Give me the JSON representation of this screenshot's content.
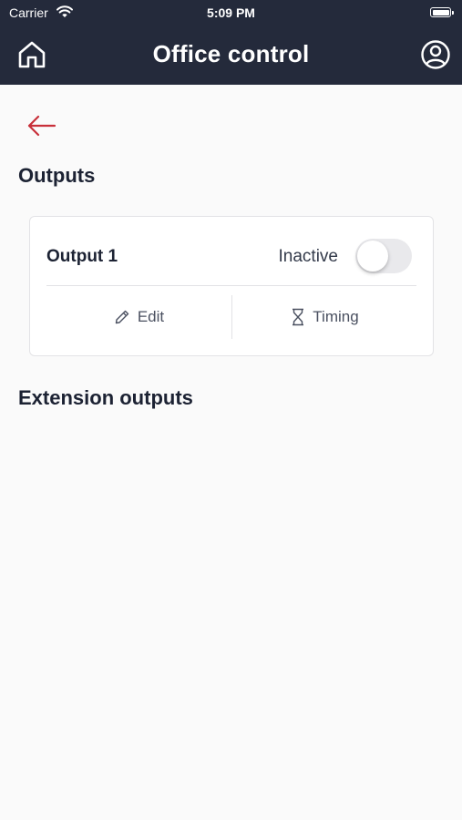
{
  "status_bar": {
    "carrier": "Carrier",
    "time": "5:09 PM"
  },
  "header": {
    "title": "Office control",
    "home_icon": "home-icon",
    "profile_icon": "user-circle-icon",
    "background_color": "#242a3b"
  },
  "back_icon": "arrow-left-icon",
  "accent_color": "#c8303a",
  "outputs_section": {
    "title": "Outputs",
    "items": [
      {
        "name": "Output 1",
        "status": "Inactive",
        "toggle_on": false,
        "edit_label": "Edit",
        "timing_label": "Timing"
      }
    ]
  },
  "extension_section": {
    "title": "Extension outputs"
  }
}
